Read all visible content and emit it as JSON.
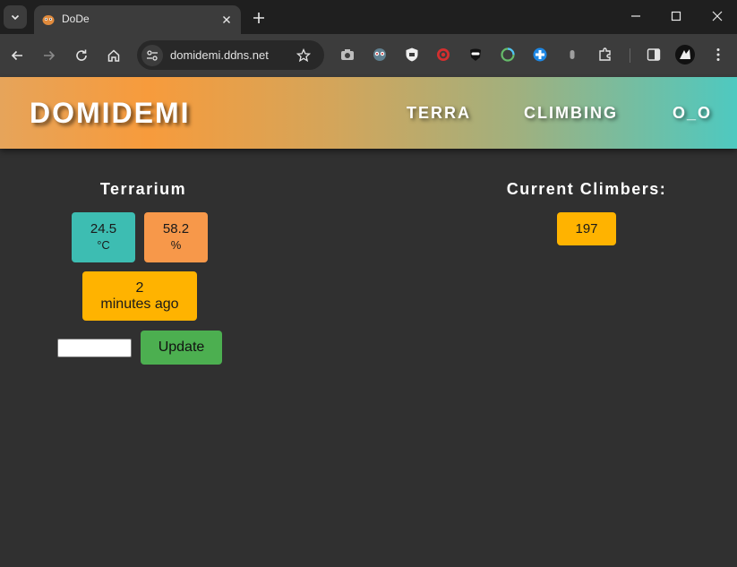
{
  "browser": {
    "tab_title": "DoDe",
    "url": "domidemi.ddns.net"
  },
  "site": {
    "logo": "DOMIDEMI",
    "nav": [
      "TERRA",
      "CLIMBING",
      "O_O"
    ]
  },
  "terrarium": {
    "title": "Terrarium",
    "temperature": {
      "value": "24.5",
      "unit": "°C"
    },
    "humidity": {
      "value": "58.2",
      "unit": "%"
    },
    "updated": {
      "value": "2",
      "unit": "minutes ago"
    },
    "input_value": "",
    "update_label": "Update"
  },
  "climbers": {
    "title": "Current Climbers:",
    "count": "197"
  },
  "colors": {
    "teal": "#3dbdb2",
    "orange": "#f7984a",
    "amber": "#ffb300",
    "green": "#4caf50",
    "background": "#303030"
  }
}
